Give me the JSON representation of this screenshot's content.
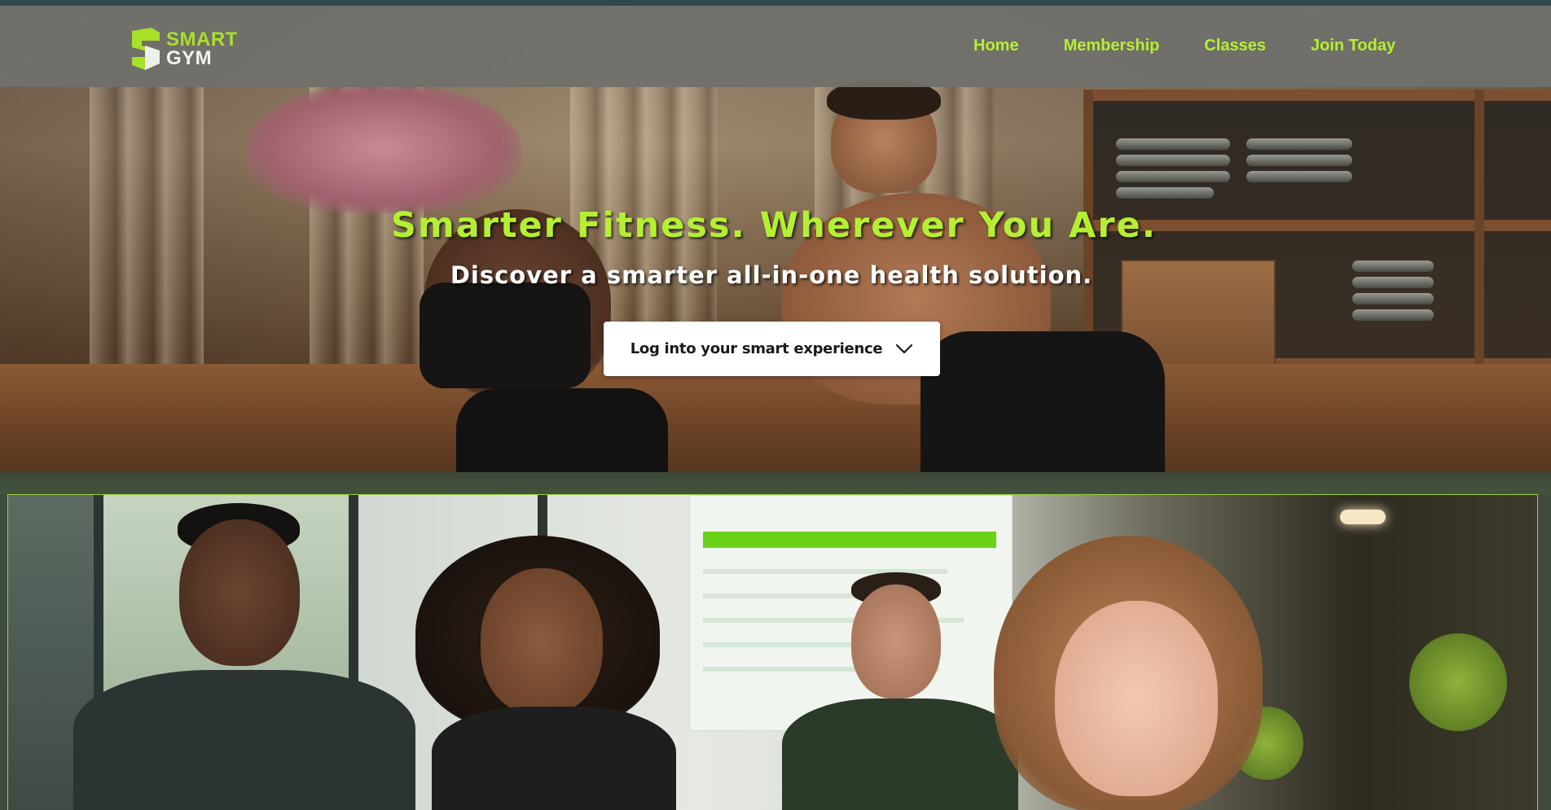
{
  "brand": {
    "logo_line1": "SMART",
    "logo_line2": "GYM",
    "accent_color": "#b4f031",
    "logo_icon": "s-shield-icon"
  },
  "nav": {
    "items": [
      {
        "label": "Home"
      },
      {
        "label": "Membership"
      },
      {
        "label": "Classes"
      },
      {
        "label": "Join Today"
      }
    ]
  },
  "hero": {
    "title": "Smarter Fitness. Wherever You Are.",
    "subtitle": "Discover a smarter all-in-one health solution.",
    "login_button_label": "Log into your smart experience",
    "login_button_icon": "chevron-down-icon"
  },
  "colors": {
    "nav_bg": "#70706c",
    "accent": "#b4f031",
    "button_bg": "#ffffff",
    "page_bg": "#3d4a3c"
  }
}
